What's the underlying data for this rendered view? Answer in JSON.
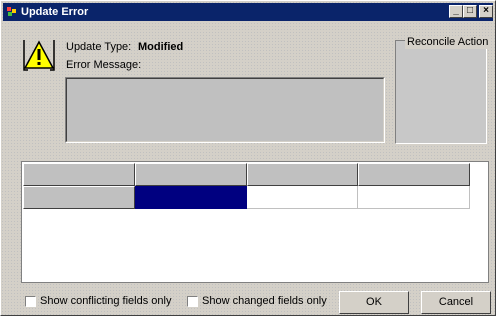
{
  "window": {
    "title": "Update Error"
  },
  "title_buttons": {
    "minimize": "_",
    "maximize": "□",
    "close": "×"
  },
  "details": {
    "update_type_label": "Update Type:",
    "update_type_value": "Modified",
    "error_message_label": "Error Message:",
    "error_message_value": ""
  },
  "reconcile": {
    "title": "Reconcile Action"
  },
  "options": {
    "show_conflicting": "Show conflicting fields only",
    "show_changed": "Show changed fields only",
    "show_conflicting_checked": false,
    "show_changed_checked": false
  },
  "buttons": {
    "ok": "OK",
    "cancel": "Cancel"
  },
  "colors": {
    "titlebar": "#0a246a",
    "selection": "#000080",
    "face": "#d4d0c8"
  }
}
